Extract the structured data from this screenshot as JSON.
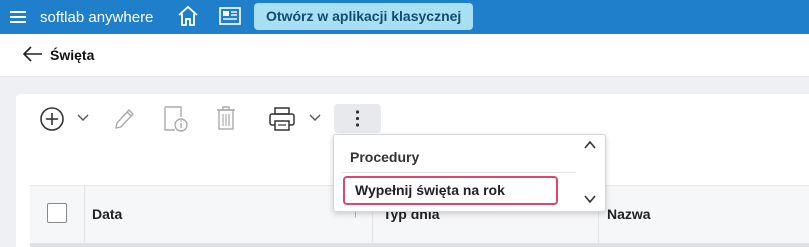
{
  "topbar": {
    "brand": "softlab anywhere",
    "open_classic_label": "Otwórz w aplikacji klasycznej",
    "accent_color": "#1f7fcb"
  },
  "page": {
    "title": "Święta"
  },
  "toolbar": {
    "icons": [
      "add-icon",
      "chevron-down-icon",
      "edit-icon",
      "details-icon",
      "delete-icon",
      "print-icon",
      "chevron-down-icon",
      "more-vertical-icon"
    ]
  },
  "dropdown": {
    "header": "Procedury",
    "items": [
      {
        "label": "Wypełnij święta na rok",
        "highlighted": true,
        "highlight_color": "#e2456c"
      }
    ]
  },
  "table": {
    "columns": [
      {
        "label": "Data",
        "sorted": "ascending"
      },
      {
        "label": "Typ dnia"
      },
      {
        "label": "Nazwa"
      }
    ]
  }
}
